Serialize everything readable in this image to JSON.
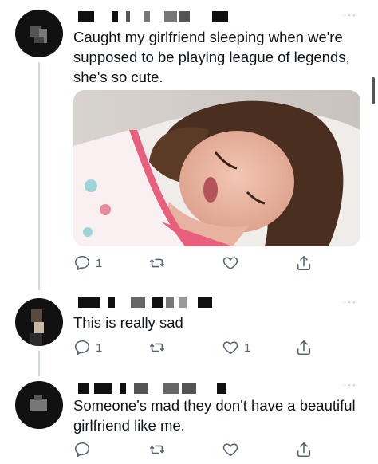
{
  "tweets": [
    {
      "text": "Caught my girlfriend sleeping when we're supposed to be playing league of legends, she's so cute.",
      "more": "···",
      "actions": {
        "reply_count": "1",
        "retweet_count": "",
        "like_count": ""
      }
    },
    {
      "text": "This is really sad",
      "more": "···",
      "actions": {
        "reply_count": "1",
        "retweet_count": "",
        "like_count": "1"
      }
    },
    {
      "text": "Someone's mad they don't have a beautiful girlfriend like me.",
      "more": "···",
      "actions": {
        "reply_count": "",
        "retweet_count": "",
        "like_count": ""
      }
    }
  ],
  "icons": {
    "reply": "reply-icon",
    "retweet": "retweet-icon",
    "like": "heart-icon",
    "share": "share-icon",
    "more": "more-options-icon"
  },
  "colors": {
    "icon": "#536471",
    "thread_line": "#cfd9de",
    "text": "#0f1419",
    "meta": "#9aa5ad"
  }
}
